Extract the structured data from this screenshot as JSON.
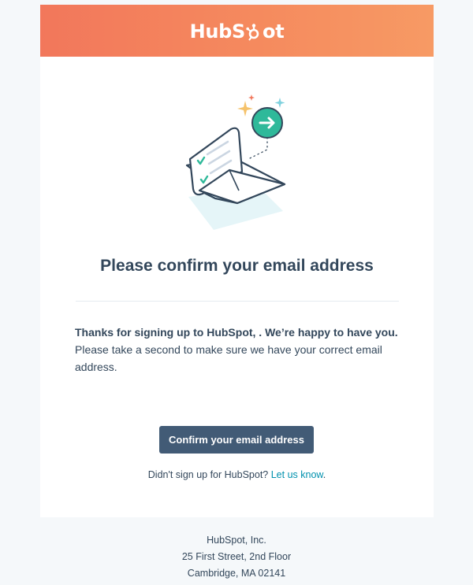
{
  "brand": {
    "logo_text_before": "HubS",
    "logo_text_after": "ot",
    "header_gradient_start": "#f2775b",
    "header_gradient_end": "#f79a64"
  },
  "main": {
    "title": "Please confirm your email address",
    "lead_text": "Thanks for signing up to HubSpot, . We’re happy to have you.",
    "body_text": "Please take a second to make sure we have your correct email address.",
    "cta_label": "Confirm your email address",
    "signup_prompt": "Didn't sign up for HubSpot?",
    "signup_link": "Let us know",
    "signup_suffix": "."
  },
  "footer": {
    "company": "HubSpot, Inc.",
    "street": "25 First Street, 2nd Floor",
    "city": "Cambridge, MA 02141"
  },
  "colors": {
    "button": "#425b76",
    "link": "#0091ae",
    "text": "#33475b",
    "accent_green": "#2fb99a",
    "page_background": "#f5f8fa"
  },
  "illustration": {
    "icon": "envelope-checklist-icon",
    "badge_icon": "arrow-right-icon"
  }
}
